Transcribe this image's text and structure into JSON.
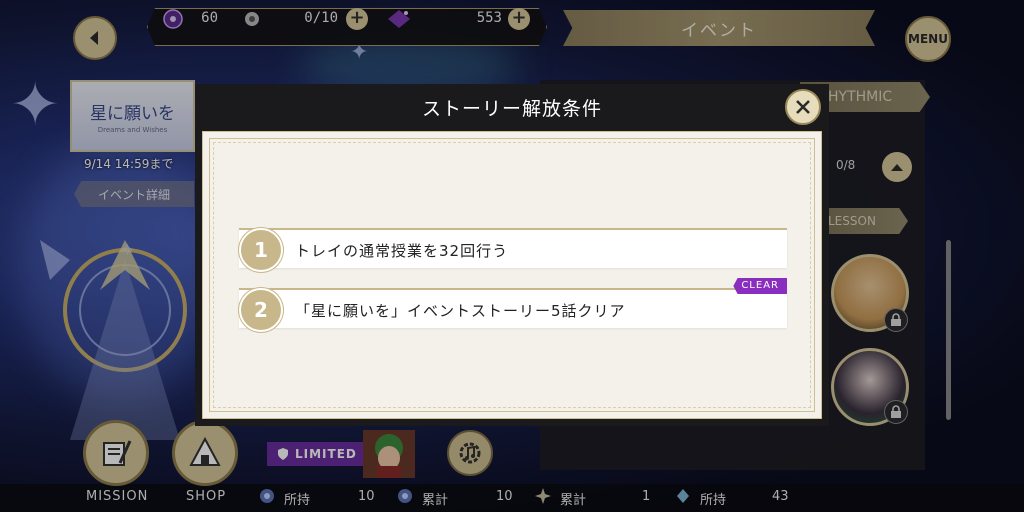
{
  "topbar": {
    "currencies": [
      {
        "icon": "gem-icon",
        "value": "60"
      },
      {
        "icon": "gear-badge-icon",
        "value": "0/10"
      },
      {
        "icon": "magic-stone-icon",
        "value": "553"
      }
    ],
    "event_tab_label": "イベント",
    "menu_label": "MENU"
  },
  "event_banner": {
    "logo_text": "星に願いを",
    "logo_sub": "Dreams and Wishes",
    "deadline": "9/14 14:59まで",
    "detail_button": "イベント詳細"
  },
  "right_panel": {
    "rhythmic_tab": "HYTHMIC",
    "progress": "0/8",
    "lesson_tab": "LESSON"
  },
  "modal": {
    "title": "ストーリー解放条件",
    "conditions": [
      {
        "number": "1",
        "text": "トレイの通常授業を32回行う",
        "cleared": false
      },
      {
        "number": "2",
        "text": "「星に願いを」イベントストーリー5話クリア",
        "cleared": true,
        "badge": "CLEAR"
      }
    ]
  },
  "bottom": {
    "mission_label": "MISSION",
    "shop_label": "SHOP",
    "limited_label": "LIMITED",
    "stats": [
      {
        "label": "所持",
        "value": "10"
      },
      {
        "label": "累計",
        "value": "10"
      },
      {
        "label": "累計",
        "value": "1"
      },
      {
        "label": "所持",
        "value": "43"
      }
    ]
  },
  "colors": {
    "gold": "#d6c69a",
    "purple_badge": "#8a2ec0",
    "modal_header": "#1a1a1c",
    "paper": "#f4f1ea"
  }
}
